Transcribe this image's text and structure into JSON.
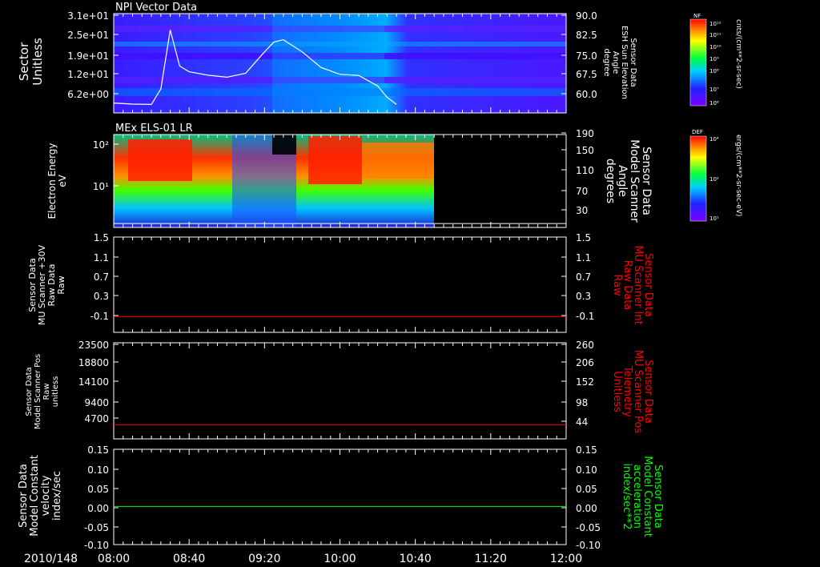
{
  "time_axis": {
    "date": "2010/148",
    "ticks": [
      "08:00",
      "08:40",
      "09:20",
      "10:00",
      "10:40",
      "11:20",
      "12:00"
    ]
  },
  "colors": {
    "background": "#000000",
    "axes": "#ffffff",
    "red_trace": "#ff0000",
    "green_trace": "#00ff00",
    "white_trace": "#ffffff"
  },
  "panels": [
    {
      "title": "NPI Vector Data",
      "left_label": [
        "Sector",
        "Unitless"
      ],
      "left_ticks": [
        "3.1e+01",
        "2.5e+01",
        "1.9e+01",
        "1.2e+01",
        "6.2e+00"
      ],
      "right_label": [
        "Sensor Data",
        "ESH Sun Elevation",
        "Angle",
        "degree"
      ],
      "right_ticks": [
        "90.0",
        "82.5",
        "75.0",
        "67.5",
        "60.0"
      ],
      "colorbar": {
        "label": "NF",
        "units": "cnts/(cm**2-sr-sec)",
        "ticks": [
          "10¹²",
          "10¹¹",
          "10¹⁰",
          "10⁹",
          "10⁸",
          "10⁷",
          "10⁶"
        ]
      }
    },
    {
      "title": "MEx ELS-01 LR",
      "left_label": [
        "Electron Energy",
        "eV"
      ],
      "left_ticks": [
        "10²",
        "10¹"
      ],
      "right_label": [
        "Sensor Data",
        "Model Scanner",
        "Angle",
        "degrees"
      ],
      "right_ticks": [
        "190",
        "150",
        "110",
        "70",
        "30"
      ],
      "colorbar": {
        "label": "DEF",
        "units": "ergs/(cm**2-sr-sec-eV)",
        "ticks": [
          "10⁴",
          "10²",
          "10¹"
        ]
      }
    },
    {
      "left_label": [
        "Sensor Data",
        "MU Scanner +30V",
        "Raw Data",
        "Raw"
      ],
      "left_ticks": [
        "1.5",
        "1.1",
        "0.7",
        "0.3",
        "-0.1"
      ],
      "right_label": [
        "Sensor Data",
        "MU Scanner Int",
        "Raw Data",
        "Raw"
      ],
      "right_ticks": [
        "1.5",
        "1.1",
        "0.7",
        "0.3",
        "-0.1"
      ]
    },
    {
      "left_label": [
        "Sensor Data",
        "Model Scanner Pos",
        "Raw",
        "unitless"
      ],
      "left_ticks": [
        "23500",
        "18800",
        "14100",
        "9400",
        "4700"
      ],
      "right_label": [
        "Sensor Data",
        "MU Scanner Pos",
        "Telemetry",
        "Unitless"
      ],
      "right_ticks": [
        "260",
        "206",
        "152",
        "98",
        "44"
      ]
    },
    {
      "left_label": [
        "Sensor Data",
        "Model Constant",
        "velocity",
        "index/sec"
      ],
      "left_ticks": [
        "0.15",
        "0.10",
        "0.05",
        "0.00",
        "-0.05",
        "-0.10"
      ],
      "right_label": [
        "Sensor Data",
        "Model Constant",
        "acceleration",
        "index/sec**2"
      ],
      "right_ticks": [
        "0.15",
        "0.10",
        "0.05",
        "0.00",
        "-0.05",
        "-0.10"
      ]
    }
  ],
  "chart_data": [
    {
      "type": "heatmap",
      "title": "NPI Vector Data",
      "xlabel": "2010/148",
      "x_range": [
        "08:00",
        "12:00"
      ],
      "ylabel": "Sector Unitless",
      "ylim": [
        0,
        32
      ],
      "overlay_line": {
        "name": "Sensor Data ESH Sun Elevation Angle",
        "units": "degree",
        "ylim": [
          55,
          90
        ],
        "x": [
          "08:00",
          "08:10",
          "08:20",
          "08:25",
          "08:30",
          "08:35",
          "08:40",
          "08:50",
          "09:00",
          "09:10",
          "09:20",
          "09:25",
          "09:30",
          "09:40",
          "09:50",
          "10:00",
          "10:10",
          "10:20",
          "10:25",
          "10:30"
        ],
        "y": [
          58.5,
          58.1,
          58.0,
          63.5,
          84.2,
          71.5,
          69.5,
          68.3,
          67.6,
          69.0,
          76.5,
          80.0,
          80.8,
          76.5,
          71.0,
          68.6,
          68.2,
          64.5,
          60.5,
          58.0
        ]
      }
    },
    {
      "type": "heatmap",
      "title": "MEx ELS-01 LR",
      "xlabel": "2010/148",
      "x_range": [
        "08:00",
        "12:00"
      ],
      "ylabel": "Electron Energy eV",
      "y_scale": "log",
      "data_x_range": [
        "08:00",
        "10:45"
      ],
      "overlay_line": {
        "name": "Sensor Data Model Scanner Angle",
        "units": "degrees",
        "ylim": [
          0,
          190
        ],
        "x": [
          "08:00",
          "10:45"
        ],
        "y": [
          8,
          8
        ]
      }
    },
    {
      "type": "line",
      "xlabel": "2010/148",
      "x_range": [
        "08:00",
        "12:00"
      ],
      "ylim": [
        -0.3,
        1.5
      ],
      "series": [
        {
          "name": "Sensor Data MU Scanner Int Raw Data",
          "x": [
            "08:00",
            "12:00"
          ],
          "values": [
            0.0,
            0.0
          ]
        }
      ]
    },
    {
      "type": "line",
      "xlabel": "2010/148",
      "x_range": [
        "08:00",
        "12:00"
      ],
      "ylim": [
        44,
        260
      ],
      "series": [
        {
          "name": "Sensor Data MU Scanner Pos Telemetry",
          "x": [
            "08:00",
            "12:00"
          ],
          "values": [
            76,
            76
          ]
        }
      ]
    },
    {
      "type": "line",
      "xlabel": "2010/148",
      "x_range": [
        "08:00",
        "12:00"
      ],
      "ylim": [
        -0.1,
        0.15
      ],
      "series": [
        {
          "name": "Sensor Data Model Constant acceleration",
          "x": [
            "08:00",
            "12:00"
          ],
          "values": [
            0.0,
            0.0
          ]
        }
      ]
    }
  ]
}
